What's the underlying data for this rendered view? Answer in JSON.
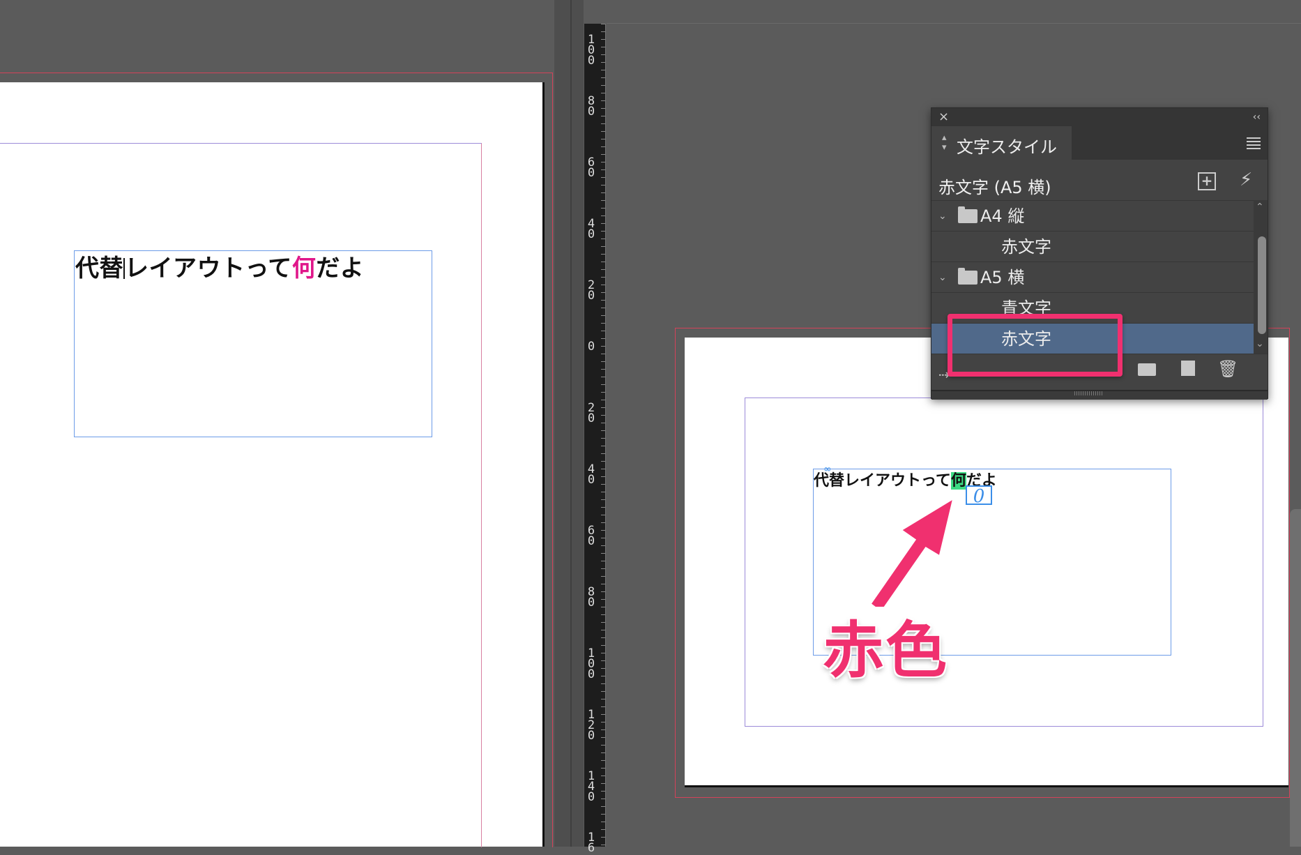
{
  "document_left": {
    "text_before": "代替",
    "text_middle": "レイアウトって",
    "text_highlight": "何",
    "text_after": "だよ"
  },
  "document_right": {
    "text_before": "代替レイアウトって",
    "text_highlight": "何",
    "text_after": "だよ",
    "overset_mark": "0"
  },
  "ruler": {
    "labels": [
      "1\n0\n0",
      "8\n0",
      "6\n0",
      "4\n0",
      "2\n0",
      "0",
      "2\n0",
      "4\n0",
      "6\n0",
      "8\n0",
      "1\n0\n0",
      "1\n2\n0",
      "1\n4\n0",
      "1\n6"
    ]
  },
  "annotation": {
    "label": "赤色",
    "color": "#f0306f"
  },
  "panel": {
    "close": "×",
    "collapse": "‹‹",
    "tab_label": "文字スタイル",
    "current_style": "赤文字 (A5 横)",
    "new_group_icon": "+",
    "clear_icon": "⚡",
    "rows": [
      {
        "type": "group",
        "label": "A4 縦"
      },
      {
        "type": "item",
        "label": "赤文字"
      },
      {
        "type": "group",
        "label": "A5 横"
      },
      {
        "type": "item",
        "label": "青文字"
      },
      {
        "type": "item",
        "label": "赤文字",
        "selected": true
      }
    ],
    "load_icon": "⇢",
    "delete_icon": "🗑"
  },
  "colors": {
    "highlight_magenta": "#e0178a",
    "highlight_green": "#3ddc84",
    "selection_blue": "#50698a"
  }
}
